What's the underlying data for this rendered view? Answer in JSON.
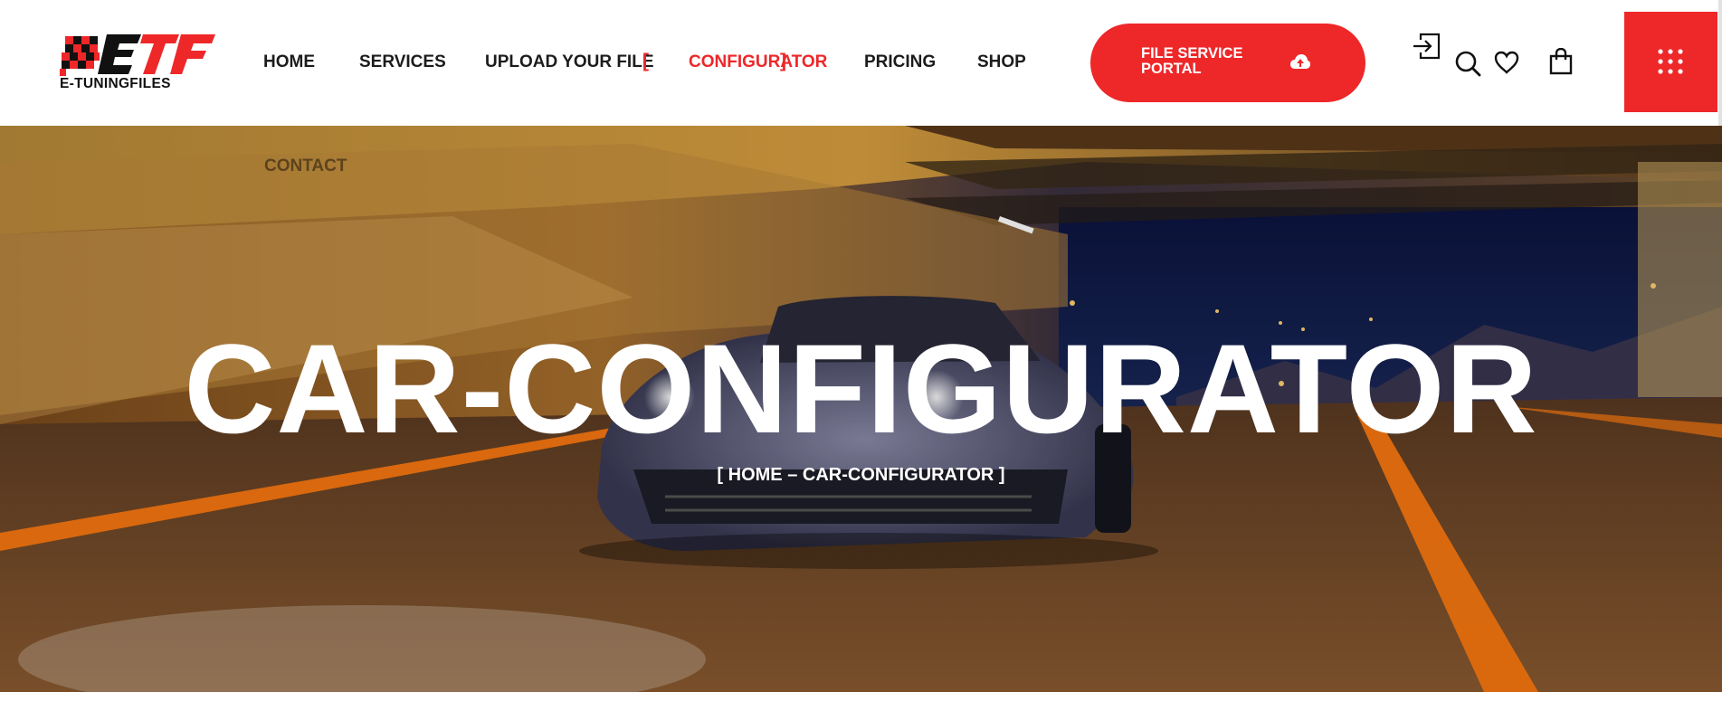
{
  "brand": {
    "logo_text": "E-TUNINGFILES",
    "accent": "#ee2729"
  },
  "nav": {
    "items": [
      {
        "label": "HOME",
        "active": false
      },
      {
        "label": "SERVICES",
        "active": false
      },
      {
        "label": "UPLOAD YOUR FILE",
        "active": false
      },
      {
        "label": "CONFIGURATOR",
        "active": true
      },
      {
        "label": "PRICING",
        "active": false
      },
      {
        "label": "SHOP",
        "active": false
      }
    ],
    "overflow_item": "CONTACT"
  },
  "header_actions": {
    "portal_button_label": "FILE SERVICE PORTAL",
    "portal_icon": "cloud-upload-icon",
    "login_icon": "login-icon",
    "search_icon": "search-icon",
    "wishlist_icon": "heart-icon",
    "cart_icon": "shopping-bag-icon",
    "menu_icon": "grid-dots-icon"
  },
  "hero": {
    "title": "CAR-CONFIGURATOR",
    "breadcrumb_open": "[",
    "breadcrumb_home": "HOME",
    "breadcrumb_sep": "–",
    "breadcrumb_current": "CAR-CONFIGURATOR",
    "breadcrumb_close": "]"
  }
}
